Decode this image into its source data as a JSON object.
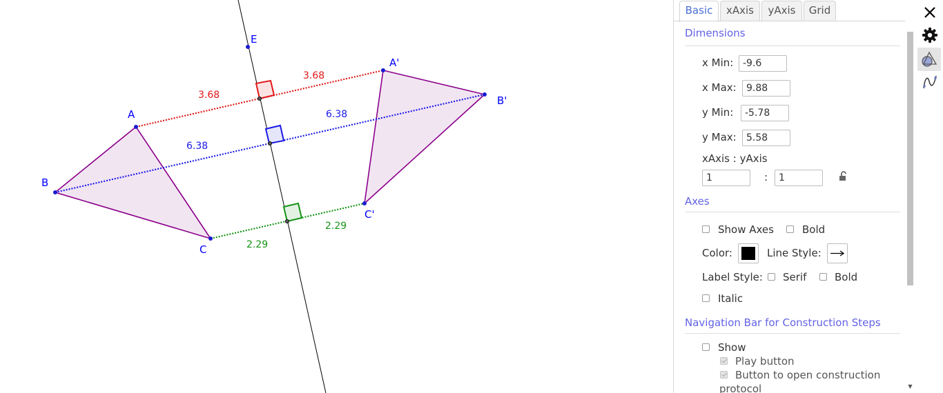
{
  "graphics": {
    "points": {
      "A": "A",
      "B": "B",
      "C": "C",
      "A_prime": "A'",
      "B_prime": "B'",
      "C_prime": "C'",
      "E": "E"
    },
    "lengths": {
      "red_left": "3.68",
      "red_right": "3.68",
      "blue_left": "6.38",
      "blue_right": "6.38",
      "green_left": "2.29",
      "green_right": "2.29"
    },
    "colors": {
      "point": "#1a1ad1",
      "label": "#0000ff",
      "polygon_stroke": "#8b008b",
      "polygon_fill": "#f2e5f2",
      "red": "#e11818",
      "blue": "#1a1ae6",
      "green": "#159315",
      "line": "#000000"
    }
  },
  "panel": {
    "tabs": [
      "Basic",
      "xAxis",
      "yAxis",
      "Grid"
    ],
    "active_tab": "Basic",
    "dimensions": {
      "title": "Dimensions",
      "xmin_label": "x Min:",
      "xmin_value": "-9.6",
      "xmax_label": "x Max:",
      "xmax_value": "9.88",
      "ymin_label": "y Min:",
      "ymin_value": "-5.78",
      "ymax_label": "y Max:",
      "ymax_value": "5.58",
      "ratio_label": "xAxis : yAxis",
      "ratio_x": "1",
      "ratio_sep": ":",
      "ratio_y": "1"
    },
    "axes": {
      "title": "Axes",
      "show_axes": "Show Axes",
      "bold": "Bold",
      "color_label": "Color:",
      "color_value": "#000000",
      "line_style_label": "Line Style:",
      "label_style_label": "Label Style:",
      "serif": "Serif",
      "bold2": "Bold",
      "italic": "Italic"
    },
    "navbar": {
      "title": "Navigation Bar for Construction Steps",
      "show": "Show",
      "play": "Play button",
      "open_protocol": "Button to open construction",
      "open_protocol_cont": "protocol"
    }
  },
  "sidebar": {
    "icons": [
      "close-icon",
      "gear-icon",
      "graphics-view-icon",
      "algebra-view-icon"
    ]
  }
}
